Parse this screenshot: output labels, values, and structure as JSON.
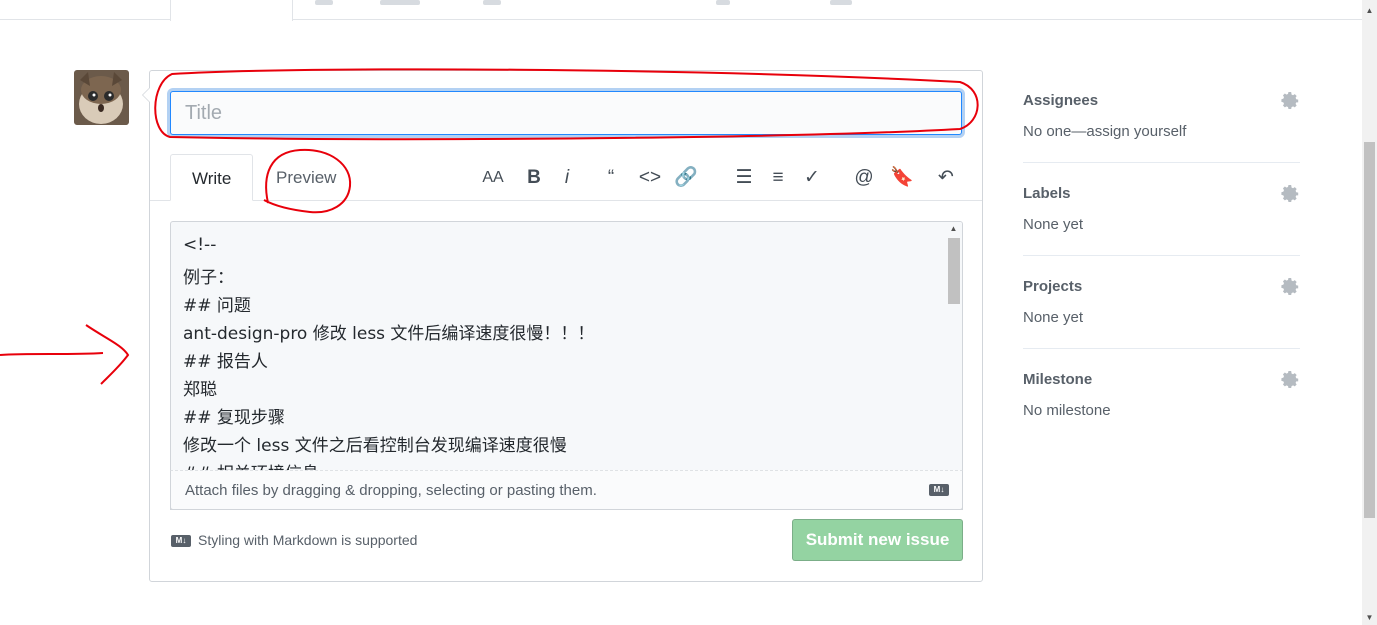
{
  "title_field": {
    "placeholder": "Title",
    "value": ""
  },
  "tabs": {
    "write": "Write",
    "preview": "Preview"
  },
  "toolbar": [
    {
      "name": "header-text-icon",
      "glyph": "AA"
    },
    {
      "name": "bold-icon",
      "glyph": "B"
    },
    {
      "name": "italic-icon",
      "glyph": "i"
    },
    {
      "name": "quote-icon",
      "glyph": "“"
    },
    {
      "name": "code-icon",
      "glyph": "<>"
    },
    {
      "name": "link-icon",
      "glyph": "🔗"
    },
    {
      "name": "bullet-list-icon",
      "glyph": "☰"
    },
    {
      "name": "numbered-list-icon",
      "glyph": "≡"
    },
    {
      "name": "task-list-icon",
      "glyph": "✓"
    },
    {
      "name": "mention-icon",
      "glyph": "@"
    },
    {
      "name": "saved-reply-icon",
      "glyph": "🔖"
    },
    {
      "name": "reply-icon",
      "glyph": "↶"
    }
  ],
  "editor": {
    "lines": [
      "<!--",
      "例子：",
      "## 问题",
      "ant-design-pro 修改 less 文件后编译速度很慢！！！",
      "## 报告人",
      "郑聪",
      "## 复现步骤",
      "修改一个 less 文件之后看控制台发现编译速度很慢",
      "## 相关环境信息"
    ]
  },
  "attach_text": "Attach files by dragging & dropping, selecting or pasting them.",
  "markdown_badge": "M↓",
  "markdown_note": "Styling with Markdown is supported",
  "submit_label": "Submit new issue",
  "sidebar": {
    "assignees": {
      "heading": "Assignees",
      "value": "No one—assign yourself"
    },
    "labels": {
      "heading": "Labels",
      "value": "None yet"
    },
    "projects": {
      "heading": "Projects",
      "value": "None yet"
    },
    "milestone": {
      "heading": "Milestone",
      "value": "No milestone"
    }
  },
  "colors": {
    "submit_bg": "#94d3a2",
    "focus_border": "#2188ff",
    "annotation_red": "#e8000b"
  }
}
